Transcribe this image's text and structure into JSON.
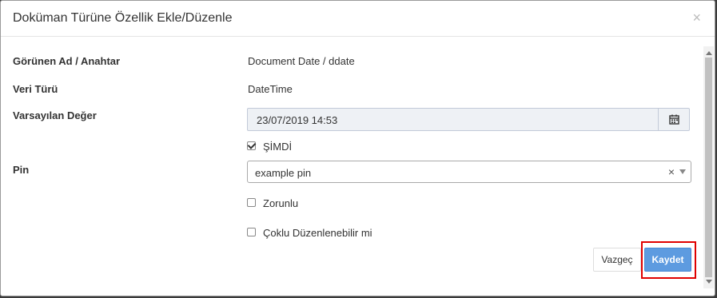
{
  "dialog": {
    "title": "Doküman Türüne Özellik Ekle/Düzenle",
    "close_glyph": "×"
  },
  "form": {
    "display_name_label": "Görünen Ad / Anahtar",
    "display_name_value": "Document Date / ddate",
    "data_type_label": "Veri Türü",
    "data_type_value": "DateTime",
    "default_value_label": "Varsayılan Değer",
    "default_value_value": "23/07/2019 14:53",
    "now_checkbox": {
      "label": "ŞİMDİ",
      "checked": true
    },
    "pin_label": "Pin",
    "pin_select": {
      "value": "example pin",
      "clear_glyph": "×"
    },
    "required_checkbox": {
      "label": "Zorunlu",
      "checked": false
    },
    "multi_edit_checkbox": {
      "label": "Çoklu Düzenlenebilir mi",
      "checked": false
    }
  },
  "footer": {
    "cancel_label": "Vazgeç",
    "save_label": "Kaydet"
  },
  "colors": {
    "save_button": "#5d9be0",
    "highlight_outline": "#e00000"
  },
  "icons": {
    "calendar": "calendar-icon",
    "close": "close-icon",
    "dropdown": "chevron-down-icon"
  }
}
